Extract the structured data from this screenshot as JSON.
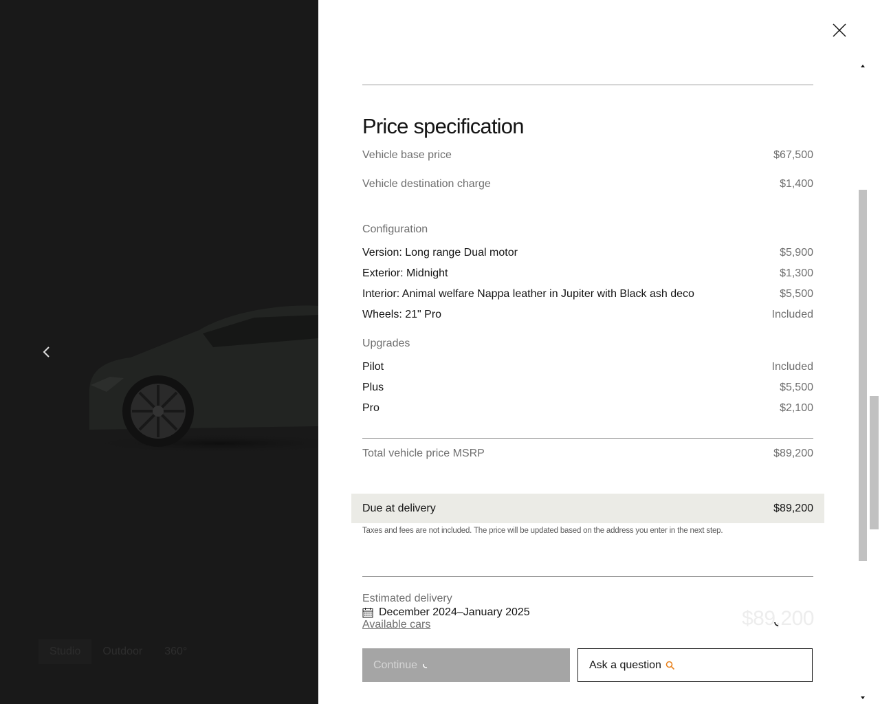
{
  "viewer": {
    "tabs": [
      "Studio",
      "Outdoor",
      "360°"
    ]
  },
  "price_spec": {
    "title": "Price specification",
    "base": {
      "label": "Vehicle base price",
      "value": "$67,500"
    },
    "destination": {
      "label": "Vehicle destination charge",
      "value": "$1,400"
    },
    "configuration": {
      "label": "Configuration",
      "items": [
        {
          "label": "Version: Long range Dual motor",
          "value": "$5,900"
        },
        {
          "label": "Exterior: Midnight",
          "value": "$1,300"
        },
        {
          "label": "Interior: Animal welfare Nappa leather in Jupiter with Black ash deco",
          "value": "$5,500"
        },
        {
          "label": "Wheels: 21\" Pro",
          "value": "Included"
        }
      ]
    },
    "upgrades": {
      "label": "Upgrades",
      "items": [
        {
          "label": "Pilot",
          "value": "Included"
        },
        {
          "label": "Plus",
          "value": "$5,500"
        },
        {
          "label": "Pro",
          "value": "$2,100"
        }
      ]
    },
    "total": {
      "label": "Total vehicle price MSRP",
      "value": "$89,200"
    },
    "due": {
      "label": "Due at delivery",
      "value": "$89,200"
    },
    "note": "Taxes and fees are not included. The price will be updated based on the address you enter in the next step."
  },
  "delivery": {
    "label": "Estimated delivery",
    "date": "December 2024–January 2025",
    "link": "Available cars",
    "price": "$89,200"
  },
  "actions": {
    "continue_label": "Continue",
    "ask_label": "Ask a question"
  },
  "colors": {
    "due_bg": "#ebebe6",
    "accent": "#e8821e",
    "continue_bg": "#a5a5a5"
  }
}
